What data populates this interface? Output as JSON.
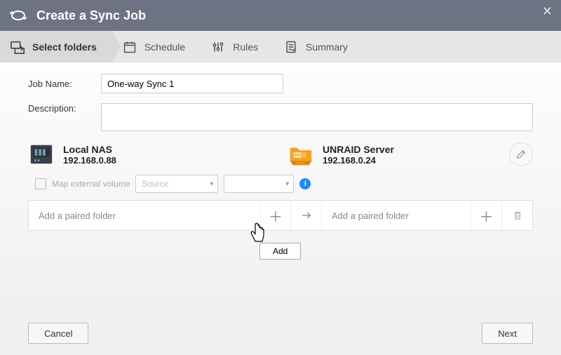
{
  "window": {
    "title": "Create a Sync Job"
  },
  "steps": {
    "select_folders": "Select folders",
    "schedule": "Schedule",
    "rules": "Rules",
    "summary": "Summary"
  },
  "form": {
    "job_name_label": "Job Name:",
    "job_name_value": "One-way Sync 1",
    "description_label": "Description:",
    "description_value": ""
  },
  "hosts": {
    "source": {
      "name": "Local NAS",
      "ip": "192.168.0.88"
    },
    "destination": {
      "name": "UNRAID Server",
      "ip": "192.168.0.24"
    }
  },
  "map_external": {
    "label": "Map external volume",
    "source_placeholder": "Source",
    "dest_placeholder": ""
  },
  "paired": {
    "source_placeholder": "Add a paired folder",
    "dest_placeholder": "Add a paired folder"
  },
  "tooltip": {
    "add": "Add"
  },
  "footer": {
    "cancel": "Cancel",
    "next": "Next"
  },
  "colors": {
    "titlebar": "#6d7382",
    "info": "#1a8cff",
    "cifs_orange": "#f6a21b"
  }
}
